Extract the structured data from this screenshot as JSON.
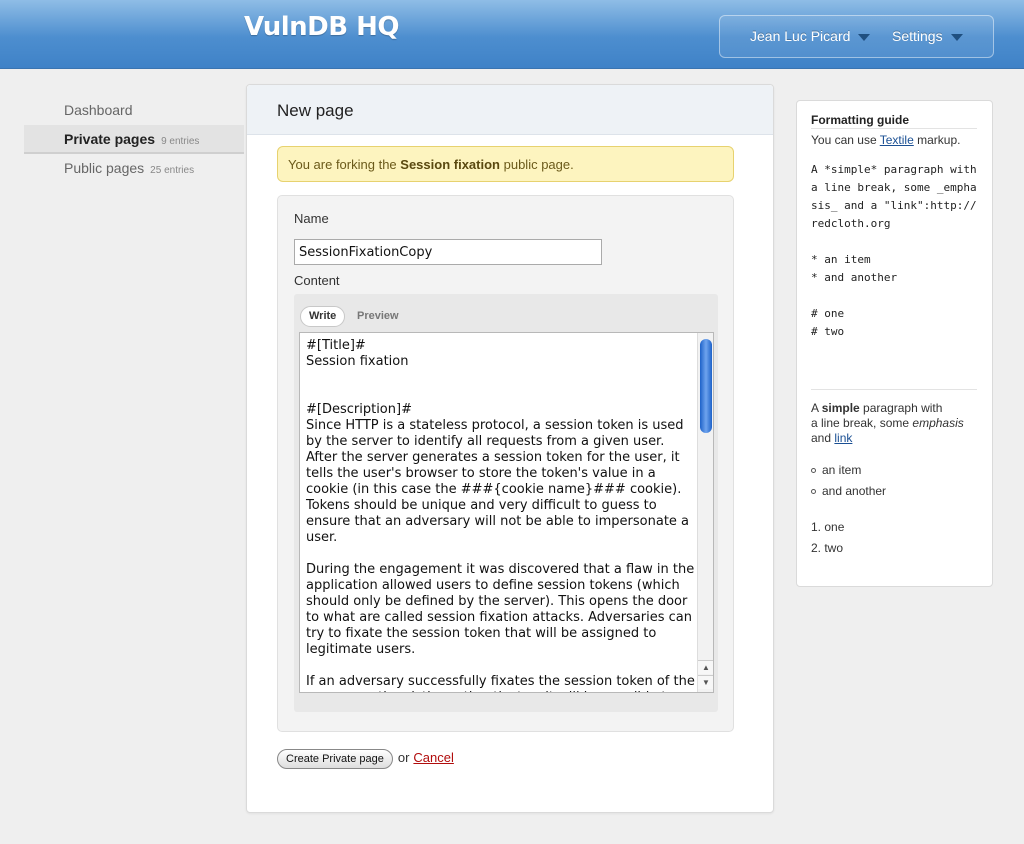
{
  "header": {
    "brand": "VulnDB HQ",
    "user_menu": "Jean Luc Picard",
    "settings_menu": "Settings"
  },
  "sidebar": {
    "items": [
      {
        "label": "Dashboard",
        "count": ""
      },
      {
        "label": "Private pages",
        "count": "9 entries"
      },
      {
        "label": "Public pages",
        "count": "25 entries"
      }
    ]
  },
  "main": {
    "title": "New page",
    "alert": {
      "prefix": "You are forking the",
      "page_name": "Session fixation",
      "suffix": "public page."
    },
    "name_label": "Name",
    "name_value": "SessionFixationCopy",
    "content_label": "Content",
    "tabs": {
      "write": "Write",
      "preview": "Preview"
    },
    "content_text": "#[Title]#\nSession fixation\n\n\n#[Description]#\nSince HTTP is a stateless protocol, a session token is used by the server to identify all requests from a given user. After the server generates a session token for the user, it tells the user's browser to store the token's value in a cookie (in this case the ###{cookie name}### cookie). Tokens should be unique and very difficult to guess to ensure that an adversary will not be able to impersonate a user.\n\nDuring the engagement it was discovered that a flaw in the application allowed users to define session tokens (which should only be defined by the server). This opens the door to what are called session fixation attacks. Adversaries can try to fixate the session token that will be assigned to legitimate users.\n\nIf an adversary successfully fixates the session token of the user, once the victim authenticates, it will be possible to",
    "submit_label": "Create Private page",
    "or_text": "or",
    "cancel_label": "Cancel"
  },
  "guide": {
    "title": "Formatting guide",
    "intro_prefix": "You can use",
    "intro_link": "Textile",
    "intro_suffix": "markup.",
    "code_sample": "A *simple* paragraph with\na line break, some _emphasis_ and a \"link\":http://redcloth.org\n\n* an item\n* and another\n\n# one\n# two",
    "render_a": "A",
    "render_strong": "simple",
    "render_b": "paragraph with",
    "render_c": "a line break, some",
    "render_em": "emphasis",
    "render_d": "and",
    "render_link": "link",
    "ul_items": [
      "an item",
      "and another"
    ],
    "ol_items": [
      "1. one",
      "2. two"
    ]
  }
}
